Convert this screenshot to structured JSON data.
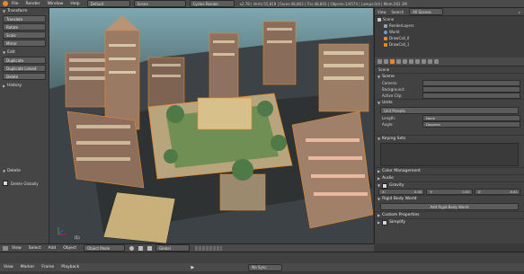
{
  "header": {
    "menus": [
      "File",
      "Render",
      "Window",
      "Help"
    ],
    "layout": "Default",
    "scene": "Scene",
    "engine": "Cycles Render",
    "stats": "v2.78 | Verts:55,819 | Faces:48,803 | Tris:48,803 | Objects:1/4574 | Lamps:0/4 | Mem:262.1M"
  },
  "toolshelf": {
    "transform_title": "Transform",
    "transform_buttons": [
      "Translate",
      "Rotate",
      "Scale",
      "Mirror"
    ],
    "edit_title": "Edit",
    "edit_buttons": [
      "Duplicate",
      "Duplicate Linked",
      "Delete"
    ],
    "history_title": "History",
    "delete_title": "Delete",
    "delete_globally": "Delete Globally"
  },
  "viewport": {
    "frame_label": "(1)"
  },
  "bottombar": {
    "menus": [
      "View",
      "Select",
      "Add",
      "Object"
    ],
    "mode": "Object Mode",
    "pivot": "Global"
  },
  "outliner": {
    "menus": [
      "View",
      "Search"
    ],
    "filter": "All Scenes",
    "items": [
      "Scene",
      "RenderLayers",
      "World",
      "DrawCall_0",
      "DrawCall_1"
    ]
  },
  "properties": {
    "breadcrumb": "Scene",
    "scene_section": "Scene",
    "camera_label": "Camera:",
    "background_label": "Background:",
    "active_clip_label": "Active Clip:",
    "units_section": "Units",
    "unit_presets": "Unit Presets",
    "length_label": "Length:",
    "length_value": "None",
    "angle_label": "Angle:",
    "angle_value": "Degrees",
    "keying_sets_section": "Keying Sets",
    "color_mgmt_section": "Color Management",
    "audio_section": "Audio",
    "gravity_section": "Gravity",
    "gravity_x_label": "X:",
    "gravity_x": "0.00",
    "gravity_y_label": "Y:",
    "gravity_y": "0.00",
    "gravity_z_label": "Z:",
    "gravity_z": "-9.81",
    "rigid_body_section": "Rigid Body World",
    "add_rigid_body": "Add Rigid Body World",
    "custom_props_section": "Custom Properties",
    "simplify_section": "Simplify"
  },
  "timeline": {
    "menus": [
      "View",
      "Marker",
      "Frame",
      "Playback"
    ],
    "sync": "No Sync"
  },
  "colors": {
    "accent": "#e7882c",
    "selected_outline": "#f0902a",
    "panel": "#424242",
    "header": "#4a4a4a"
  }
}
